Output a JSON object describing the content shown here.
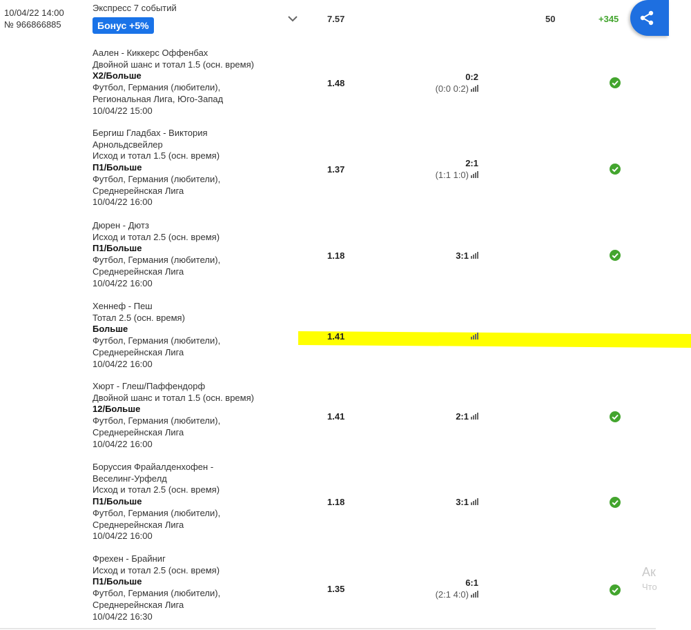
{
  "header": {
    "date": "10/04/22 14:00",
    "number": "№ 966866885",
    "title": "Экспресс 7 событий",
    "bonus": "Бонус +5%",
    "coef": "7.57",
    "stake": "50",
    "win": "+345",
    "share_icon": "share-icon",
    "expand_icon": "chevron-down-icon"
  },
  "colors": {
    "accent": "#1e6fe0",
    "win": "#43a52e",
    "highlight": "#ffff00"
  },
  "events": [
    {
      "match": "Аален - Киккерс Оффенбах",
      "market": "Двойной шанс и тотал 1.5 (осн. время)",
      "selection": "Х2/Больше",
      "league1": "Футбол, Германия (любители),",
      "league2": "Региональная Лига, Юго-Запад",
      "date": "10/04/22 15:00",
      "coef": "1.48",
      "score": "0:2",
      "score_half": "(0:0 0:2)",
      "status": "check-icon"
    },
    {
      "match": "Бергиш Гладбах - Виктория",
      "match2": "Арнольдсвейлер",
      "market": "Исход и тотал 1.5 (осн. время)",
      "selection": "П1/Больше",
      "league1": "Футбол, Германия (любители),",
      "league2": "Среднерейнская Лига",
      "date": "10/04/22 16:00",
      "coef": "1.37",
      "score": "2:1",
      "score_half": "(1:1 1:0)",
      "status": "check-icon"
    },
    {
      "match": "Дюрен - Дютз",
      "market": "Исход и тотал 2.5 (осн. время)",
      "selection": "П1/Больше",
      "league1": "Футбол, Германия (любители),",
      "league2": "Среднерейнская Лига",
      "date": "10/04/22 16:00",
      "coef": "1.18",
      "score": "3:1",
      "score_half": "",
      "status": "check-icon"
    },
    {
      "match": "Хеннеф - Пеш",
      "market": "Тотал 2.5 (осн. время)",
      "selection": "Больше",
      "league1": "Футбол, Германия (любители),",
      "league2": "Среднерейнская Лига",
      "date": "10/04/22 16:00",
      "coef": "1.41",
      "score": "",
      "score_half": "",
      "status": ""
    },
    {
      "match": "Хюрт - Глеш/Паффендорф",
      "market": "Двойной шанс и тотал 1.5 (осн. время)",
      "selection": "12/Больше",
      "league1": "Футбол, Германия (любители),",
      "league2": "Среднерейнская Лига",
      "date": "10/04/22 16:00",
      "coef": "1.41",
      "score": "2:1",
      "score_half": "",
      "status": "check-icon"
    },
    {
      "match": "Боруссия Фрайалденхофен -",
      "match2": "Веселинг-Урфелд",
      "market": "Исход и тотал 2.5 (осн. время)",
      "selection": "П1/Больше",
      "league1": "Футбол, Германия (любители),",
      "league2": "Среднерейнская Лига",
      "date": "10/04/22 16:00",
      "coef": "1.18",
      "score": "3:1",
      "score_half": "",
      "status": "check-icon"
    },
    {
      "match": "Фрехен - Брайниг",
      "market": "Исход и тотал 2.5 (осн. время)",
      "selection": "П1/Больше",
      "league1": "Футбол, Германия (любители),",
      "league2": "Среднерейнская Лига",
      "date": "10/04/22 16:30",
      "coef": "1.35",
      "score": "6:1",
      "score_half": "(2:1 4:0)",
      "status": "check-icon"
    }
  ],
  "watermark": {
    "line1": "Ак",
    "line2": "Что"
  }
}
